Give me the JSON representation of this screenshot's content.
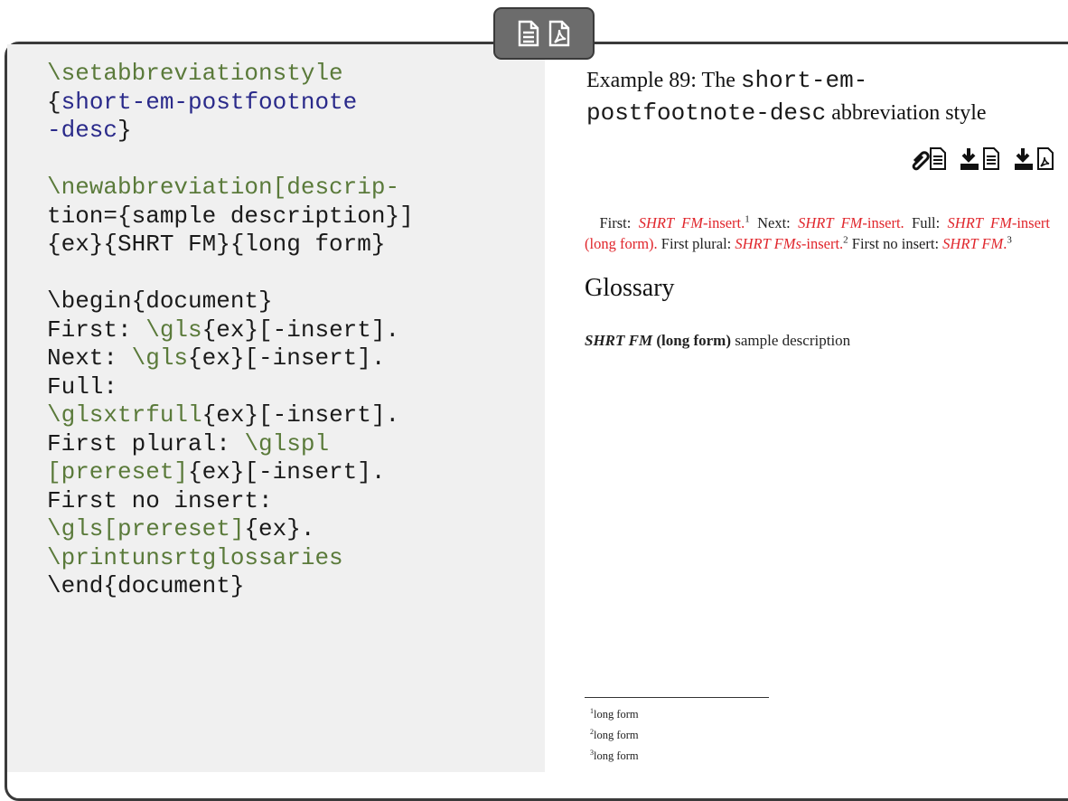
{
  "code": {
    "lines": [
      [
        {
          "t": "\\setabbreviationstyle",
          "c": "cmd"
        }
      ],
      [
        {
          "t": "{",
          "c": ""
        },
        {
          "t": "short-em-postfootnote",
          "c": "arg"
        }
      ],
      [
        {
          "t": "-desc",
          "c": "arg"
        },
        {
          "t": "}",
          "c": ""
        }
      ],
      [],
      [
        {
          "t": "\\newabbreviation[descrip-",
          "c": "cmd"
        }
      ],
      [
        {
          "t": "tion={sample description}]",
          "c": ""
        }
      ],
      [
        {
          "t": "{ex}{SHRT FM}{long form}",
          "c": ""
        }
      ],
      [],
      [
        {
          "t": "\\begin{document}",
          "c": ""
        }
      ],
      [
        {
          "t": "First: ",
          "c": ""
        },
        {
          "t": "\\gls",
          "c": "cmd"
        },
        {
          "t": "{ex}[-insert].",
          "c": ""
        }
      ],
      [
        {
          "t": "Next: ",
          "c": ""
        },
        {
          "t": "\\gls",
          "c": "cmd"
        },
        {
          "t": "{ex}[-insert].",
          "c": ""
        }
      ],
      [
        {
          "t": "Full:",
          "c": ""
        }
      ],
      [
        {
          "t": "\\glsxtrfull",
          "c": "cmd"
        },
        {
          "t": "{ex}[-insert].",
          "c": ""
        }
      ],
      [
        {
          "t": "First plural: ",
          "c": ""
        },
        {
          "t": "\\glspl",
          "c": "cmd"
        }
      ],
      [
        {
          "t": "[prereset]",
          "c": "cmd"
        },
        {
          "t": "{ex}[-insert].",
          "c": ""
        }
      ],
      [
        {
          "t": "First no insert:",
          "c": ""
        }
      ],
      [
        {
          "t": "\\gls[prereset]",
          "c": "cmd"
        },
        {
          "t": "{ex}.",
          "c": ""
        }
      ],
      [
        {
          "t": "\\printunsrtglossaries",
          "c": "cmd"
        }
      ],
      [
        {
          "t": "\\end{document}",
          "c": ""
        }
      ]
    ]
  },
  "example": {
    "title_prefix": "Example 89: The ",
    "title_code": "short-em-\npostfootnote-desc",
    "title_suffix": " abbreviation style",
    "icons": [
      "attachment-source-icon",
      "download-source-icon",
      "download-pdf-icon"
    ]
  },
  "output": {
    "para": [
      {
        "t": "First: ",
        "k": "n"
      },
      {
        "t": "SHRT FM",
        "k": "sc"
      },
      {
        "t": "-insert.",
        "k": "gl"
      },
      {
        "t": "1",
        "k": "sup"
      },
      {
        "t": "  Next: ",
        "k": "n"
      },
      {
        "t": "SHRT FM",
        "k": "sc"
      },
      {
        "t": "-insert.",
        "k": "gl"
      },
      {
        "t": " Full: ",
        "k": "n"
      },
      {
        "t": "SHRT FM",
        "k": "sc"
      },
      {
        "t": "-insert (long form).",
        "k": "gl"
      },
      {
        "t": " First plural: ",
        "k": "n"
      },
      {
        "t": "SHRT FMs",
        "k": "sc"
      },
      {
        "t": "-insert.",
        "k": "gl"
      },
      {
        "t": "2",
        "k": "sup"
      },
      {
        "t": " First no insert: ",
        "k": "n"
      },
      {
        "t": "SHRT FM",
        "k": "sc"
      },
      {
        "t": ".",
        "k": "gl"
      },
      {
        "t": "3",
        "k": "sup"
      }
    ],
    "glossary_heading": "Glossary",
    "entry_term": "SHRT FM",
    "entry_long": "(long form)",
    "entry_desc": "sample description",
    "footnotes": [
      {
        "num": "1",
        "text": "long form"
      },
      {
        "num": "2",
        "text": "long form"
      },
      {
        "num": "3",
        "text": "long form"
      }
    ]
  },
  "colors": {
    "command": "#5a7a3a",
    "argument": "#2a2a8a",
    "link": "#e0252b",
    "code_bg": "#f0f0f0"
  }
}
